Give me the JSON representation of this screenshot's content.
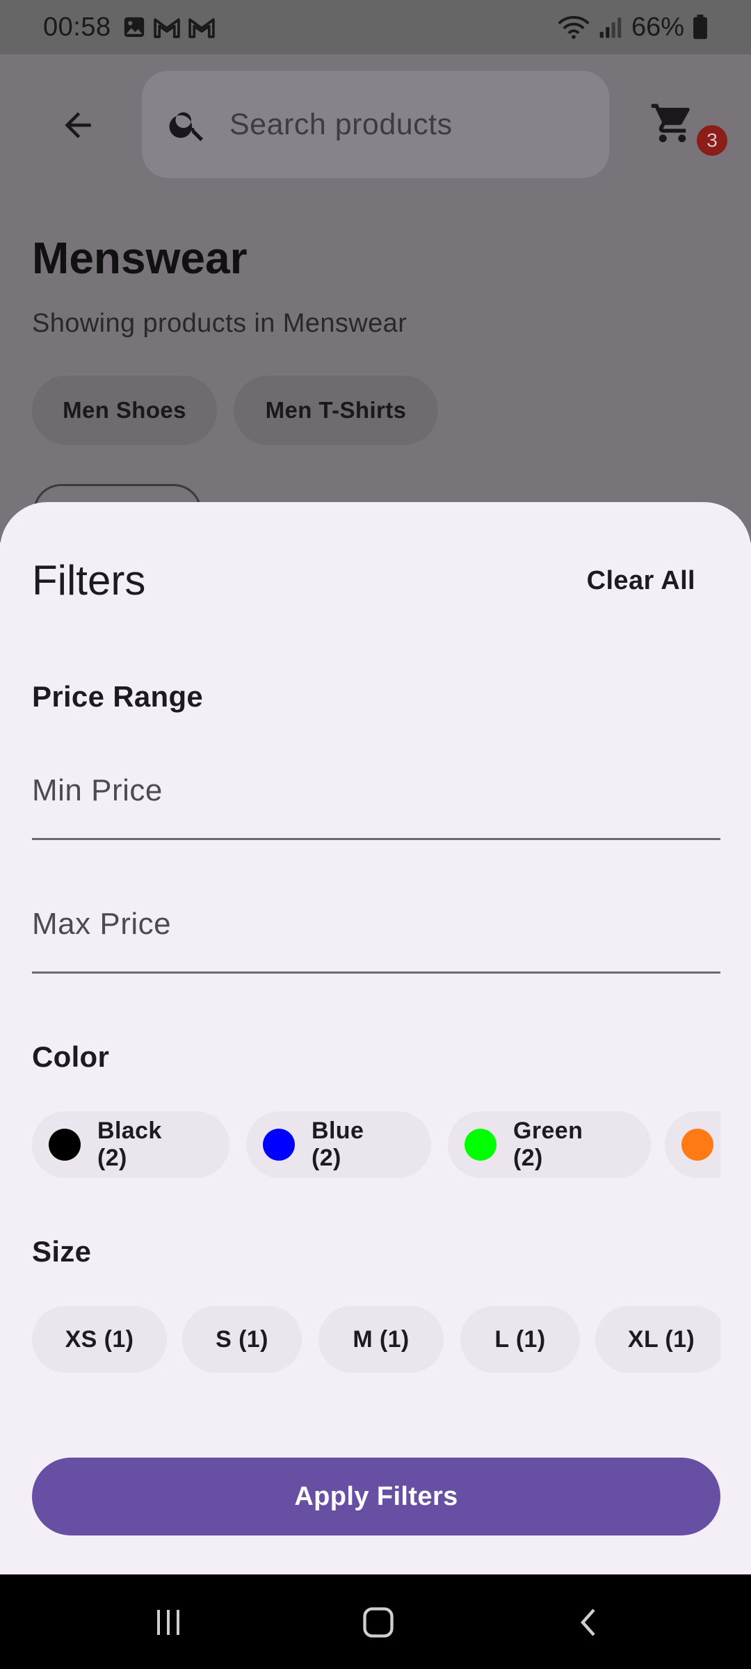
{
  "status_bar": {
    "time": "00:58",
    "battery": "66%"
  },
  "app_bar": {
    "search_placeholder": "Search products",
    "cart_count": "3"
  },
  "page": {
    "title": "Menswear",
    "subtitle": "Showing products in Menswear",
    "subcategories": [
      {
        "label": "Men Shoes"
      },
      {
        "label": "Men T-Shirts"
      }
    ]
  },
  "filters": {
    "title": "Filters",
    "clear_all": "Clear All",
    "price_range": {
      "heading": "Price Range",
      "min_placeholder": "Min Price",
      "max_placeholder": "Max Price"
    },
    "color": {
      "heading": "Color",
      "options": [
        {
          "label": "Black (2)",
          "swatch": "#000000"
        },
        {
          "label": "Blue (2)",
          "swatch": "#0000ff"
        },
        {
          "label": "Green (2)",
          "swatch": "#00ff00"
        },
        {
          "label": "",
          "swatch": "#ff7a14"
        }
      ]
    },
    "size": {
      "heading": "Size",
      "options": [
        {
          "label": "XS (1)"
        },
        {
          "label": "S (1)"
        },
        {
          "label": "M (1)"
        },
        {
          "label": "L (1)"
        },
        {
          "label": "XL (1)"
        }
      ]
    },
    "apply_label": "Apply Filters"
  },
  "colors": {
    "primary": "#6750a4",
    "sheet_background": "#f4eff6",
    "chip_background": "#ebe5ed",
    "badge": "#8c1d18"
  }
}
